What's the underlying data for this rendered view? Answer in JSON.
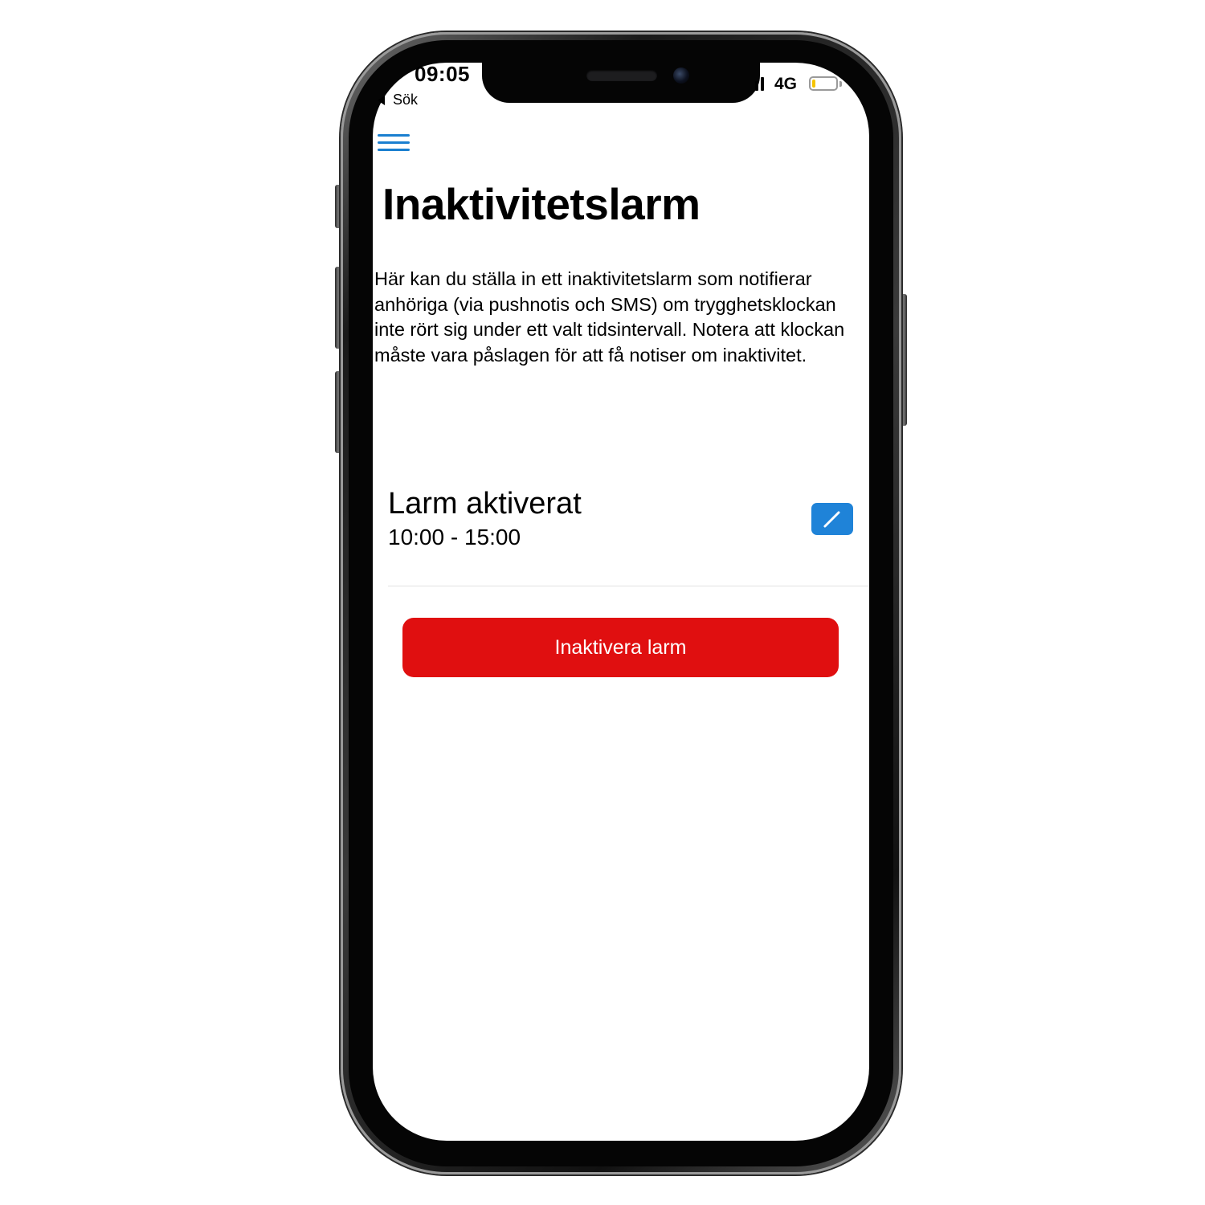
{
  "status_bar": {
    "time": "09:05",
    "back_label": "Sök",
    "network": "4G",
    "battery_level": 0.15
  },
  "header": {
    "menu_icon": "hamburger-menu-icon",
    "title": "Inaktivitetslarm"
  },
  "main": {
    "description": "Här kan du ställa in ett inaktivitetslarm som notifierar anhöriga (via pushnotis och SMS) om trygghetsklockan inte rört sig under ett valt tidsintervall. Notera att klockan måste vara påslagen för att få notiser om inaktivitet.",
    "alarm": {
      "status": "Larm aktiverat",
      "interval": "10:00 - 15:00",
      "edit_icon": "pencil-icon"
    },
    "deactivate_label": "Inaktivera larm"
  },
  "colors": {
    "accent": "#1f83d8",
    "danger": "#e00f10",
    "battery": "#f5c400"
  }
}
